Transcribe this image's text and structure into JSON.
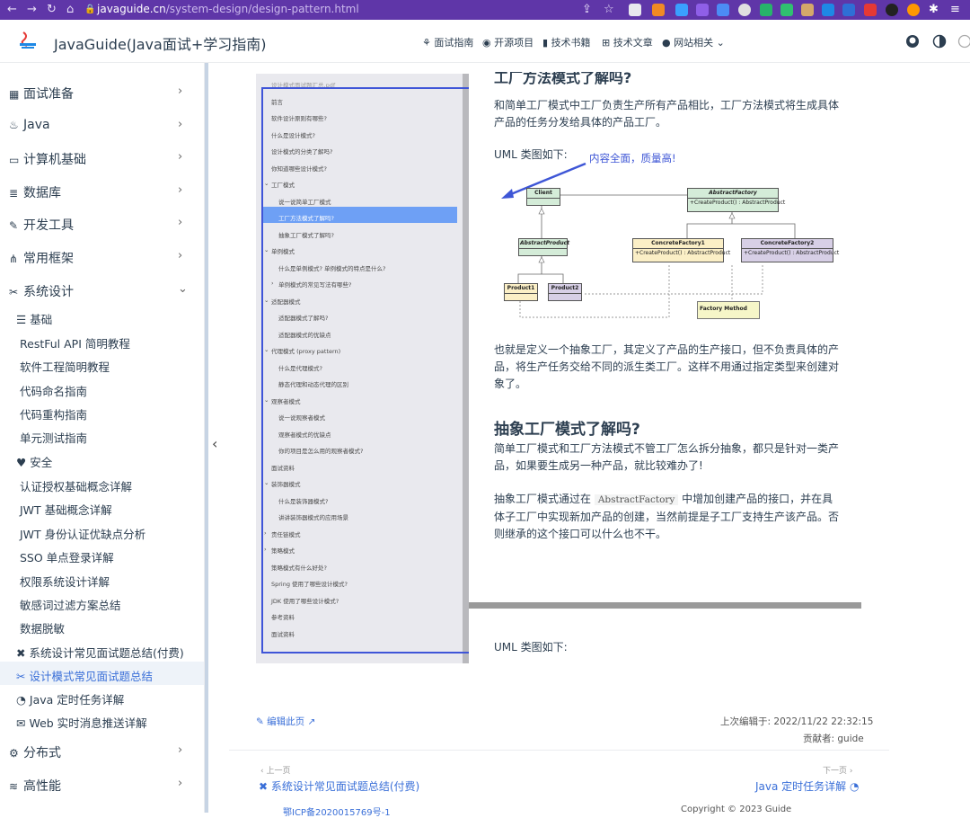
{
  "browser": {
    "url_host": "javaguide.cn",
    "url_path": "/system-design/design-pattern.html"
  },
  "header": {
    "title": "JavaGuide(Java面试+学习指南)",
    "nav": [
      {
        "label": "面试指南",
        "icon": "book-icon"
      },
      {
        "label": "开源项目",
        "icon": "github-icon"
      },
      {
        "label": "技术书籍",
        "icon": "book-stack-icon"
      },
      {
        "label": "技术文章",
        "icon": "article-icon"
      },
      {
        "label": "网站相关",
        "icon": "info-icon"
      }
    ]
  },
  "sidebar": {
    "groups": [
      {
        "label": "面试准备",
        "icon": "calendar-icon"
      },
      {
        "label": "Java",
        "icon": "java-icon"
      },
      {
        "label": "计算机基础",
        "icon": "computer-icon"
      },
      {
        "label": "数据库",
        "icon": "database-icon"
      },
      {
        "label": "开发工具",
        "icon": "tool-icon"
      },
      {
        "label": "常用框架",
        "icon": "framework-icon"
      },
      {
        "label": "系统设计",
        "icon": "design-icon"
      }
    ],
    "sub_basic": "基础",
    "basic_items": [
      "RestFul API 简明教程",
      "软件工程简明教程",
      "代码命名指南",
      "代码重构指南",
      "单元测试指南"
    ],
    "sub_security": "安全",
    "security_items": [
      "认证授权基础概念详解",
      "JWT 基础概念详解",
      "JWT 身份认证优缺点分析",
      "SSO 单点登录详解",
      "权限系统设计详解",
      "敏感词过滤方案总结",
      "数据脱敏"
    ],
    "extra_items": [
      "系统设计常见面试题总结(付费)",
      "设计模式常见面试题总结",
      "Java 定时任务详解",
      "Web 实时消息推送详解"
    ],
    "bottom_groups": [
      {
        "label": "分布式",
        "icon": "distributed-icon"
      },
      {
        "label": "高性能",
        "icon": "performance-icon"
      }
    ]
  },
  "toc": {
    "items": [
      "设计模式面试题汇总.pdf",
      "前言",
      "软件设计原则有哪些?",
      "什么是设计模式?",
      "设计模式的分类了解吗?",
      "你知道哪些设计模式?",
      "工厂模式",
      "说一说简单工厂模式",
      "工厂方法模式了解吗?",
      "抽象工厂模式了解吗?",
      "单例模式",
      "什么是单例模式? 单例模式的特点是什么?",
      "单例模式的常见写法有哪些?",
      "适配器模式",
      "适配器模式了解吗?",
      "适配器模式的优缺点",
      "代理模式 (proxy pattern)",
      "什么是代理模式?",
      "静态代理和动态代理的区别",
      "观察者模式",
      "说一说观察者模式",
      "观察者模式的优缺点",
      "你的项目是怎么用的观察者模式?",
      "面试资料",
      "装饰器模式",
      "什么是装饰器模式?",
      "讲讲装饰器模式的应用场景",
      "责任链模式",
      "策略模式",
      "策略模式有什么好处?",
      "Spring 使用了哪些设计模式?",
      "JDK 使用了哪些设计模式?",
      "参考资料",
      "面试资料"
    ]
  },
  "doc": {
    "heading1": "工厂方法模式了解吗?",
    "p1": "和简单工厂模式中工厂负责生产所有产品相比，工厂方法模式将生成具体产品的任务分发给具体的产品工厂。",
    "uml_label": "UML 类图如下:",
    "annotation": "内容全面，质量高!",
    "uml": {
      "client": "Client",
      "abstract_factory": "AbstractFactory",
      "abstract_factory_op": "+CreateProduct() : AbstractProduct",
      "abstract_product": "AbstractProduct",
      "cf1": "ConcreteFactory1",
      "cf1_op": "+CreateProduct() : AbstractProduct",
      "cf2": "ConcreteFactory2",
      "cf2_op": "+CreateProduct() : AbstractProduct",
      "product1": "Product1",
      "product2": "Product2",
      "note": "Factory Method"
    },
    "p2": "也就是定义一个抽象工厂，其定义了产品的生产接口，但不负责具体的产品，将生产任务交给不同的派生类工厂。这样不用通过指定类型来创建对象了。",
    "heading2": "抽象工厂模式了解吗?",
    "p3": "简单工厂模式和工厂方法模式不管工厂怎么拆分抽象，都只是针对一类产品，如果要生成另一种产品，就比较难办了!",
    "p4_before": "抽象工厂模式通过在",
    "p4_code": "AbstractFactory",
    "p4_after": "中增加创建产品的接口，并在具体子工厂中实现新加产品的创建，当然前提是子工厂支持生产该产品。否则继承的这个接口可以什么也不干。",
    "uml_label2": "UML 类图如下:"
  },
  "footer": {
    "edit": "编辑此页",
    "last_updated_label": "上次编辑于:",
    "last_updated": "2022/11/22 22:32:15",
    "contributors_label": "贡献者:",
    "contributors": "guide",
    "prev_label": "上一页",
    "prev_title": "系统设计常见面试题总结(付费)",
    "next_label": "下一页",
    "next_title": "Java 定时任务详解",
    "icp": "鄂ICP备2020015769号-1",
    "copyright": "Copyright © 2023 Guide"
  }
}
